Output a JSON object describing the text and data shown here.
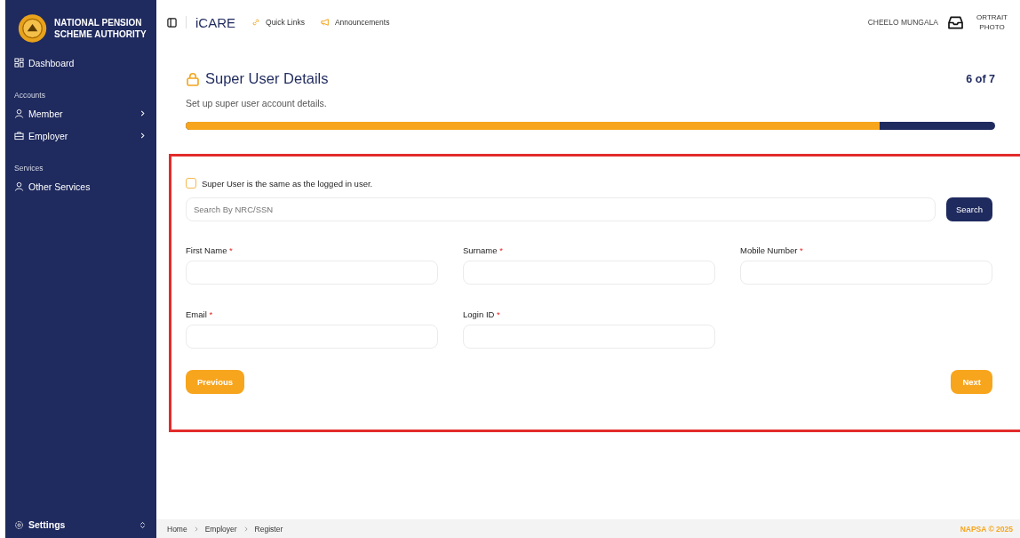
{
  "sidebar": {
    "org_name": "NATIONAL PENSION SCHEME AUTHORITY",
    "items": [
      {
        "kind": "link",
        "label": "Dashboard",
        "expandable": false
      },
      {
        "kind": "heading",
        "label": "Accounts"
      },
      {
        "kind": "link",
        "label": "Member",
        "expandable": true
      },
      {
        "kind": "link",
        "label": "Employer",
        "expandable": true
      },
      {
        "kind": "heading",
        "label": "Services"
      },
      {
        "kind": "link",
        "label": "Other Services",
        "expandable": false
      }
    ],
    "settings": {
      "label": "Settings"
    }
  },
  "topbar": {
    "app_name": "iCARE",
    "links": [
      {
        "label": "Quick Links"
      },
      {
        "label": "Announcements"
      }
    ],
    "user_name": "CHEELO MUNGALA",
    "portrait_alt": [
      "ORTRAIT",
      "PHOTO"
    ]
  },
  "page": {
    "title": "Super User Details",
    "step": "6 of 7",
    "subtitle": "Set up super user account details.",
    "progress": {
      "level": 0.857
    }
  },
  "form": {
    "same_user": {
      "label": "Super User is the same as the logged in user.",
      "checked": false
    },
    "search": {
      "placeholder": "Search By NRC/SSN",
      "button": "Search"
    },
    "rows": [
      [
        {
          "label": "First Name",
          "required_mark": "*"
        },
        {
          "label": "Surname",
          "required_mark": "*"
        },
        {
          "label": "Mobile Number",
          "required_mark": "*"
        }
      ],
      [
        {
          "label": "Email",
          "required_mark": "*"
        },
        {
          "label": "Login ID",
          "required_mark": "*"
        }
      ]
    ],
    "previous": "Previous",
    "next": "Next"
  },
  "footer": {
    "breadcrumbs": [
      "Home",
      "Employer",
      "Register"
    ],
    "copyright": "NAPSA © 2025"
  }
}
